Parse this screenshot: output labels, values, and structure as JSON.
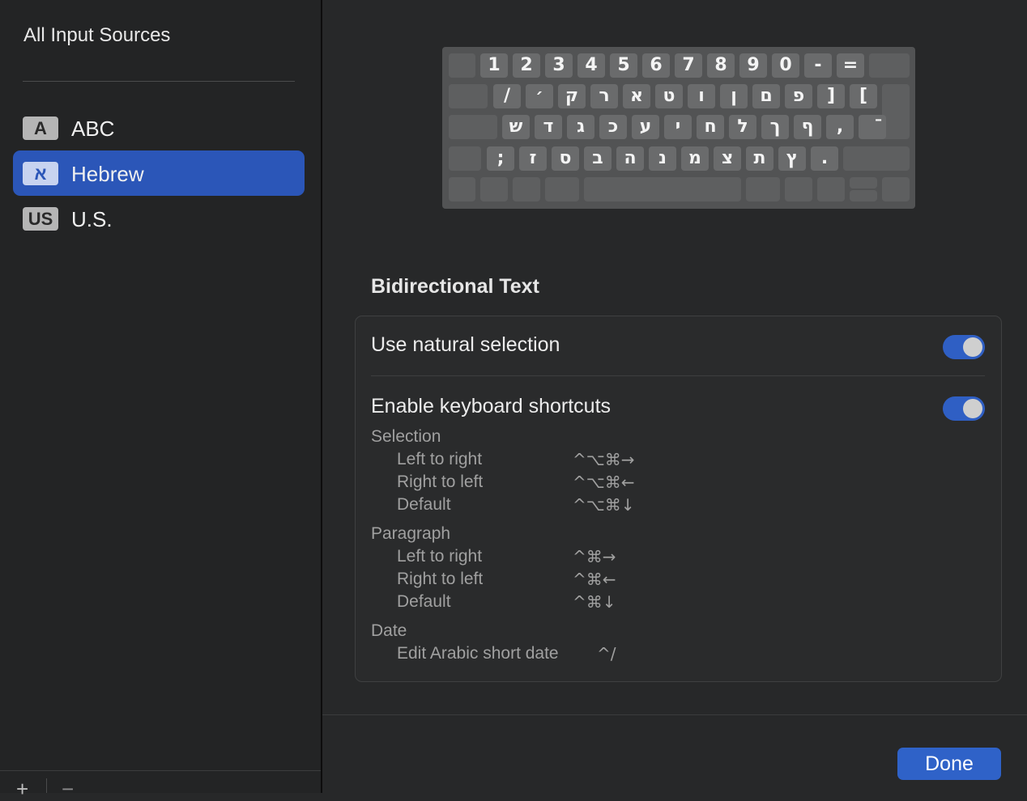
{
  "sidebar": {
    "title": "All Input Sources",
    "items": [
      {
        "badge": "A",
        "label": "ABC",
        "selected": false
      },
      {
        "badge": "א",
        "label": "Hebrew",
        "selected": true
      },
      {
        "badge": "US",
        "label": "U.S.",
        "selected": false
      }
    ],
    "add_label": "+",
    "remove_label": "−"
  },
  "keyboard": {
    "row1": [
      "",
      "1",
      "2",
      "3",
      "4",
      "5",
      "6",
      "7",
      "8",
      "9",
      "0",
      "-",
      "=",
      ""
    ],
    "row2": [
      "",
      "/",
      "׳",
      "ק",
      "ר",
      "א",
      "ט",
      "ו",
      "ן",
      "ם",
      "פ",
      "]",
      "[",
      ""
    ],
    "row3": [
      "",
      "ש",
      "ד",
      "ג",
      "כ",
      "ע",
      "י",
      "ח",
      "ל",
      "ך",
      "ף",
      ",",
      "ֿ"
    ],
    "row4": [
      "",
      ";",
      "ז",
      "ס",
      "ב",
      "ה",
      "נ",
      "מ",
      "צ",
      "ת",
      "ץ",
      ".",
      ""
    ],
    "row5": [
      "",
      "",
      "",
      "",
      "",
      "",
      "",
      "",
      ""
    ]
  },
  "bidi": {
    "section_title": "Bidirectional Text",
    "natural_selection_label": "Use natural selection",
    "natural_selection_on": true,
    "shortcuts_label": "Enable keyboard shortcuts",
    "shortcuts_on": true,
    "groups": {
      "selection": {
        "title": "Selection",
        "items": [
          {
            "label": "Left to right",
            "keys": "^⌥⌘→"
          },
          {
            "label": "Right to left",
            "keys": "^⌥⌘←"
          },
          {
            "label": "Default",
            "keys": "^⌥⌘↓"
          }
        ]
      },
      "paragraph": {
        "title": "Paragraph",
        "items": [
          {
            "label": "Left to right",
            "keys": "^⌘→"
          },
          {
            "label": "Right to left",
            "keys": "^⌘←"
          },
          {
            "label": "Default",
            "keys": "^⌘↓"
          }
        ]
      },
      "date": {
        "title": "Date",
        "items": [
          {
            "label": "Edit Arabic short date",
            "keys": "^/"
          }
        ]
      }
    }
  },
  "done_label": "Done",
  "colors": {
    "accent": "#2f62c8",
    "selection": "#2b56b8"
  }
}
